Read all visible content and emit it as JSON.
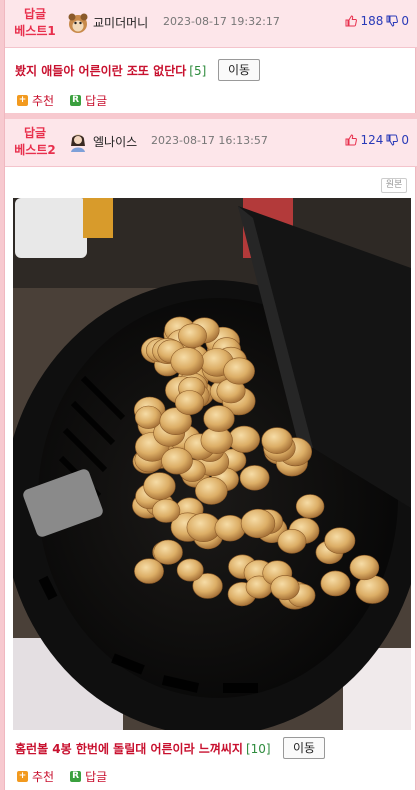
{
  "posts": [
    {
      "badge_line1": "답글",
      "badge_line2": "베스트1",
      "author": "교미더머니",
      "timestamp": "2023-08-17 19:32:17",
      "upvotes": "188",
      "downvotes": "0",
      "title": "봤지 애들아 어른이란 조또 없단다",
      "comment_count": "[5]",
      "move_label": "이동",
      "recommend_label": "추천",
      "reply_label": "답글"
    },
    {
      "badge_line1": "답글",
      "badge_line2": "베스트2",
      "author": "엘나이스",
      "timestamp": "2023-08-17 16:13:57",
      "upvotes": "124",
      "downvotes": "0",
      "original_label": "원본",
      "title": "홈런볼 4봉 한번에 돌릴대 어른이라 느껴씨지",
      "comment_count": "[10]",
      "move_label": "이동",
      "recommend_label": "추천",
      "reply_label": "답글"
    }
  ],
  "colors": {
    "page_bg": "#f7c9cf",
    "header_bg": "#fde6ea",
    "badge_red": "#e8304d",
    "title_red": "#c8102e",
    "count_green": "#2e8b3d",
    "vote_blue": "#2a3bb8"
  }
}
